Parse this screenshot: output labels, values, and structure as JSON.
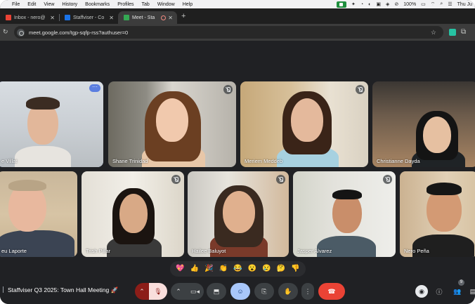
{
  "menubar": {
    "items": [
      "File",
      "Edit",
      "View",
      "History",
      "Bookmarks",
      "Profiles",
      "Tab",
      "Window",
      "Help"
    ],
    "battery": "100%",
    "clock": "Thu Ju"
  },
  "tabs": [
    {
      "label": "Inbox - nero@",
      "favicon_color": "#ea4335",
      "active": false
    },
    {
      "label": "Staffviser - Co",
      "favicon_color": "#1a73e8",
      "active": false
    },
    {
      "label": "Meet - Sta",
      "favicon_color": "#34a853",
      "active": true
    }
  ],
  "address": {
    "url": "meet.google.com/tgp-sqfp-rss?authuser=0"
  },
  "participants": [
    {
      "name": "e Villat",
      "muted": false,
      "options": true
    },
    {
      "name": "Shane Trinidad",
      "muted": true
    },
    {
      "name": "Meriem Meddeb",
      "muted": true
    },
    {
      "name": "Christianne Dayda",
      "muted": false
    },
    {
      "name": "eu Laporte",
      "muted": false
    },
    {
      "name": "Trish Pillar",
      "muted": true
    },
    {
      "name": "Hailee Baluyot",
      "muted": true
    },
    {
      "name": "Jasper Alvarez",
      "muted": true
    },
    {
      "name": "Nero Peña",
      "muted": false
    }
  ],
  "reactions": [
    "💖",
    "👍",
    "🎉",
    "👏",
    "😂",
    "😮",
    "😢",
    "🤔",
    "👎"
  ],
  "meeting": {
    "title": "Staffviser Q3 2025: Town Hall Meeting 🚀"
  },
  "people_count": "9",
  "colors": {
    "end_call": "#ea4335",
    "accent": "#a8c7fa",
    "background": "#202124"
  }
}
